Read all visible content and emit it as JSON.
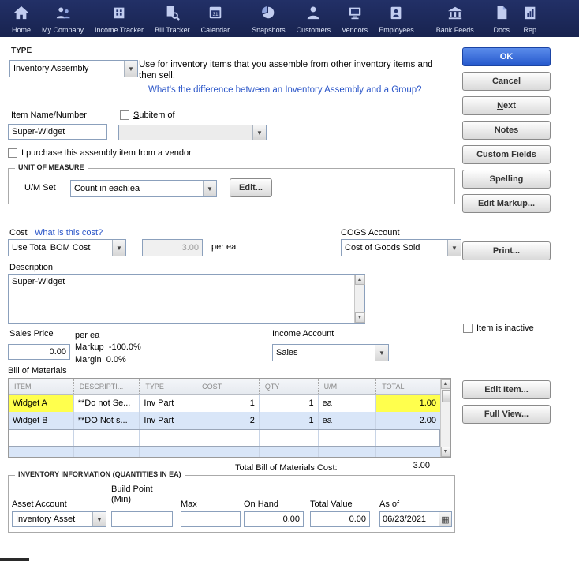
{
  "icons": {
    "chevron_down": "▼",
    "scroll_up": "▲",
    "scroll_down": "▼",
    "calendar": "▦"
  },
  "toolbar": {
    "items": [
      {
        "label": "Home"
      },
      {
        "label": "My Company"
      },
      {
        "label": "Income Tracker"
      },
      {
        "label": "Bill Tracker"
      },
      {
        "label": "Calendar"
      },
      {
        "label": "Snapshots"
      },
      {
        "label": "Customers"
      },
      {
        "label": "Vendors"
      },
      {
        "label": "Employees"
      },
      {
        "label": "Bank Feeds"
      },
      {
        "label": "Docs"
      },
      {
        "label": "Rep"
      }
    ]
  },
  "type": {
    "label": "TYPE",
    "value": "Inventory Assembly",
    "description": "Use for inventory items that you assemble from other inventory items and then sell.",
    "link": "What's the difference between an Inventory Assembly and a Group?"
  },
  "item": {
    "name_label": "Item Name/Number",
    "name_value": "Super-Widget",
    "subitem_label": "Subitem of",
    "purchase_label": "I purchase this assembly item from a vendor"
  },
  "uom": {
    "legend": "UNIT OF MEASURE",
    "set_label": "U/M Set",
    "set_value": "Count in each:ea",
    "edit_button": "Edit..."
  },
  "cost": {
    "label": "Cost",
    "help_link": "What is this cost?",
    "method_value": "Use Total BOM Cost",
    "amount": "3.00",
    "per_unit": "per ea",
    "cogs_label": "COGS Account",
    "cogs_value": "Cost of Goods Sold"
  },
  "description": {
    "label": "Description",
    "value": "Super-Widget"
  },
  "sales": {
    "price_label": "Sales Price",
    "price_value": "0.00",
    "per_unit": "per ea",
    "markup_label": "Markup",
    "markup_value": "-100.0%",
    "margin_label": "Margin",
    "margin_value": "0.0%",
    "income_label": "Income Account",
    "income_value": "Sales",
    "inactive_label": "Item is inactive"
  },
  "bom": {
    "label": "Bill of Materials",
    "headers": [
      "ITEM",
      "DESCRIPTI...",
      "TYPE",
      "COST",
      "QTY",
      "U/M",
      "TOTAL"
    ],
    "rows": [
      {
        "item": "Widget A",
        "desc": "**Do not Se...",
        "type": "Inv Part",
        "cost": "1",
        "qty": "1",
        "um": "ea",
        "total": "1.00"
      },
      {
        "item": "Widget B",
        "desc": "**DO Not s...",
        "type": "Inv Part",
        "cost": "2",
        "qty": "1",
        "um": "ea",
        "total": "2.00"
      }
    ],
    "total_label": "Total Bill of Materials Cost:",
    "total_value": "3.00"
  },
  "inventory": {
    "legend": "INVENTORY INFORMATION (QUANTITIES IN EA)",
    "asset_label": "Asset Account",
    "asset_value": "Inventory Asset",
    "build_point_label": "Build Point",
    "build_point_label2": "(Min)",
    "max_label": "Max",
    "on_hand_label": "On Hand",
    "on_hand_value": "0.00",
    "total_value_label": "Total Value",
    "total_value_value": "0.00",
    "as_of_label": "As of",
    "as_of_value": "06/23/2021"
  },
  "buttons": {
    "ok": "OK",
    "cancel": "Cancel",
    "next": "Next",
    "notes": "Notes",
    "custom_fields": "Custom Fields",
    "spelling": "Spelling",
    "edit_markup": "Edit Markup...",
    "print": "Print...",
    "edit_item": "Edit Item...",
    "full_view": "Full View..."
  },
  "colors": {
    "toolbar_bg": "#1c2a5e",
    "ok_blue": "#2558cc",
    "highlight_yellow": "#ffff4d",
    "row_alt": "#d9e6f8",
    "link_blue": "#2a55c8"
  }
}
